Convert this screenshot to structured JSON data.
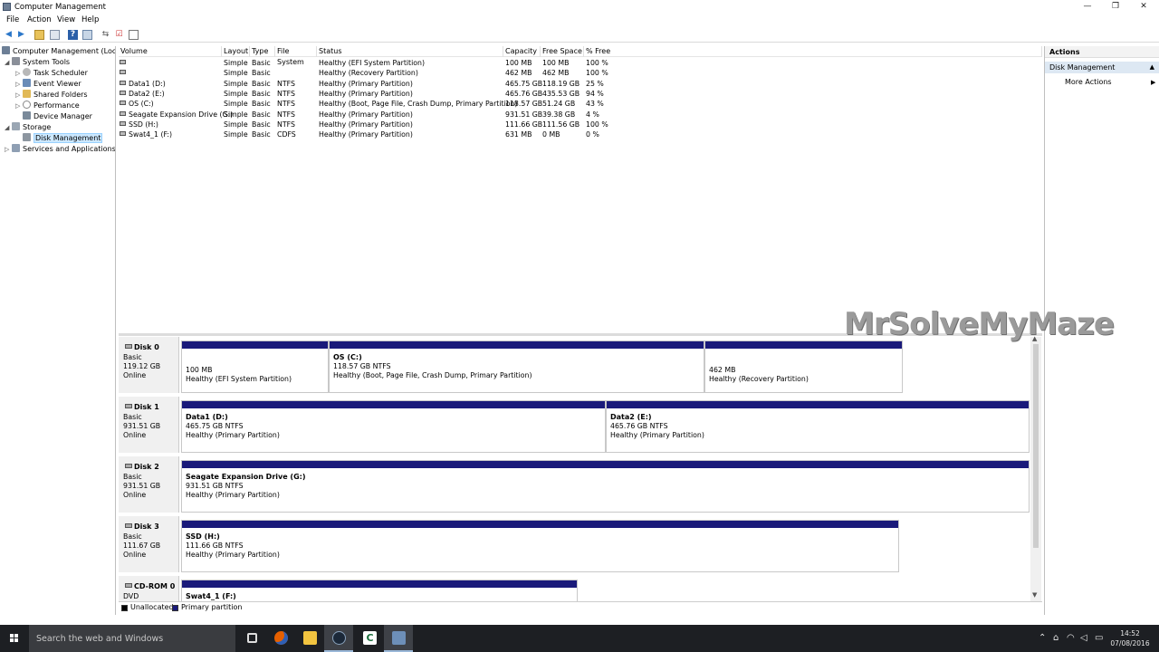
{
  "window": {
    "title": "Computer Management",
    "minimize": "—",
    "restore": "❐",
    "close": "✕"
  },
  "menu": [
    "File",
    "Action",
    "View",
    "Help"
  ],
  "toolbar_icons": [
    "back-icon",
    "forward-icon",
    "up-folder-icon",
    "show-hide-tree-icon",
    "help-icon",
    "properties-icon",
    "connect-icon",
    "check-icon",
    "panel-icon"
  ],
  "tree": {
    "root": "Computer Management (Local",
    "system_tools": "System Tools",
    "task_scheduler": "Task Scheduler",
    "event_viewer": "Event Viewer",
    "shared_folders": "Shared Folders",
    "performance": "Performance",
    "device_manager": "Device Manager",
    "storage": "Storage",
    "disk_management": "Disk Management",
    "services": "Services and Applications"
  },
  "volume_list": {
    "headers": [
      "Volume",
      "Layout",
      "Type",
      "File System",
      "Status",
      "Capacity",
      "Free Space",
      "% Free"
    ],
    "rows": [
      [
        "",
        "Simple",
        "Basic",
        "",
        "Healthy (EFI System Partition)",
        "100 MB",
        "100 MB",
        "100 %"
      ],
      [
        "",
        "Simple",
        "Basic",
        "",
        "Healthy (Recovery Partition)",
        "462 MB",
        "462 MB",
        "100 %"
      ],
      [
        "Data1 (D:)",
        "Simple",
        "Basic",
        "NTFS",
        "Healthy (Primary Partition)",
        "465.75 GB",
        "118.19 GB",
        "25 %"
      ],
      [
        "Data2 (E:)",
        "Simple",
        "Basic",
        "NTFS",
        "Healthy (Primary Partition)",
        "465.76 GB",
        "435.53 GB",
        "94 %"
      ],
      [
        "OS (C:)",
        "Simple",
        "Basic",
        "NTFS",
        "Healthy (Boot, Page File, Crash Dump, Primary Partition)",
        "118.57 GB",
        "51.24 GB",
        "43 %"
      ],
      [
        "Seagate Expansion Drive (G:)",
        "Simple",
        "Basic",
        "NTFS",
        "Healthy (Primary Partition)",
        "931.51 GB",
        "39.38 GB",
        "4 %"
      ],
      [
        "SSD (H:)",
        "Simple",
        "Basic",
        "NTFS",
        "Healthy (Primary Partition)",
        "111.66 GB",
        "111.56 GB",
        "100 %"
      ],
      [
        "Swat4_1 (F:)",
        "Simple",
        "Basic",
        "CDFS",
        "Healthy (Primary Partition)",
        "631 MB",
        "0 MB",
        "0 %"
      ]
    ]
  },
  "disks": [
    {
      "name": "Disk 0",
      "type": "Basic",
      "size": "119.12 GB",
      "state": "Online",
      "partitions": [
        {
          "name": "",
          "size": "100 MB",
          "status": "Healthy (EFI System Partition)"
        },
        {
          "name": "OS  (C:)",
          "size": "118.57 GB NTFS",
          "status": "Healthy (Boot, Page File, Crash Dump, Primary Partition)"
        },
        {
          "name": "",
          "size": "462 MB",
          "status": "Healthy (Recovery Partition)"
        }
      ]
    },
    {
      "name": "Disk 1",
      "type": "Basic",
      "size": "931.51 GB",
      "state": "Online",
      "partitions": [
        {
          "name": "Data1  (D:)",
          "size": "465.75 GB NTFS",
          "status": "Healthy (Primary Partition)"
        },
        {
          "name": "Data2  (E:)",
          "size": "465.76 GB NTFS",
          "status": "Healthy (Primary Partition)"
        }
      ]
    },
    {
      "name": "Disk 2",
      "type": "Basic",
      "size": "931.51 GB",
      "state": "Online",
      "partitions": [
        {
          "name": "Seagate Expansion Drive  (G:)",
          "size": "931.51 GB NTFS",
          "status": "Healthy (Primary Partition)"
        }
      ]
    },
    {
      "name": "Disk 3",
      "type": "Basic",
      "size": "111.67 GB",
      "state": "Online",
      "partitions": [
        {
          "name": "SSD  (H:)",
          "size": "111.66 GB NTFS",
          "status": "Healthy (Primary Partition)"
        }
      ]
    },
    {
      "name": "CD-ROM 0",
      "type": "DVD",
      "size": "",
      "state": "",
      "partitions": [
        {
          "name": "Swat4_1  (F:)",
          "size": "",
          "status": ""
        }
      ]
    }
  ],
  "legend": {
    "unallocated": "Unallocated",
    "primary": "Primary partition",
    "unallocated_color": "#000000",
    "primary_color": "#1a1a7a"
  },
  "actions": {
    "header": "Actions",
    "group": "Disk Management",
    "more": "More Actions",
    "group_caret": "▲",
    "more_caret": "▶"
  },
  "watermark": "MrSolveMyMaze",
  "taskbar": {
    "search_placeholder": "Search the web and Windows",
    "apps": [
      "task-view-icon",
      "firefox-icon",
      "file-explorer-icon",
      "steam-icon",
      "camtasia-icon",
      "computer-management-icon"
    ],
    "time": "14:52",
    "date": "07/08/2016"
  }
}
